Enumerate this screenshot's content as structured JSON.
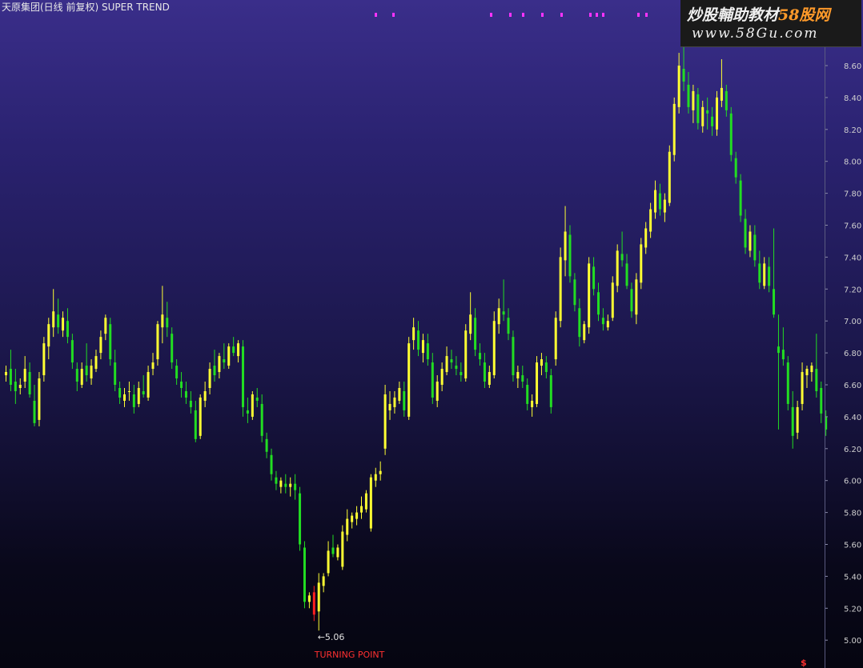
{
  "header": {
    "title": "天原集团(日线 前复权) SUPER TREND"
  },
  "watermark": {
    "text_main": "炒股輔助教材",
    "text_brand": "58股网",
    "url": "www.58Gu.com"
  },
  "axis_marker": "$",
  "colors": {
    "up": "#ffff33",
    "down": "#22dd22",
    "turn": "#ff2020",
    "annotation_low": "#e0e0e0",
    "annotation_turn": "#ff3030",
    "top_markers": "#ff33ff"
  },
  "chart_data": {
    "type": "candlestick",
    "title": "天原集团(日线 前复权) SUPER TREND",
    "ylim": [
      4.9,
      8.8
    ],
    "y_ticks": [
      "5.00",
      "5.20",
      "5.40",
      "5.60",
      "5.80",
      "6.00",
      "6.20",
      "6.40",
      "6.60",
      "6.80",
      "7.00",
      "7.20",
      "7.40",
      "7.60",
      "7.80",
      "8.00",
      "8.20",
      "8.40",
      "8.60"
    ],
    "grid": false,
    "annotations": {
      "low_label": "←5.06",
      "low_value": 5.06,
      "turning_label": "TURNING POINT"
    },
    "candles": [
      [
        6.66,
        6.72,
        6.62,
        6.68
      ],
      [
        6.7,
        6.82,
        6.56,
        6.6
      ],
      [
        6.62,
        6.7,
        6.48,
        6.56
      ],
      [
        6.58,
        6.64,
        6.54,
        6.6
      ],
      [
        6.62,
        6.78,
        6.58,
        6.7
      ],
      [
        6.68,
        6.74,
        6.52,
        6.54
      ],
      [
        6.5,
        6.6,
        6.34,
        6.36
      ],
      [
        6.38,
        6.68,
        6.34,
        6.64
      ],
      [
        6.66,
        6.9,
        6.62,
        6.86
      ],
      [
        6.84,
        7.02,
        6.76,
        6.98
      ],
      [
        6.96,
        7.2,
        6.9,
        7.06
      ],
      [
        7.04,
        7.14,
        6.92,
        6.96
      ],
      [
        6.94,
        7.06,
        6.9,
        7.02
      ],
      [
        7.0,
        7.08,
        6.86,
        6.9
      ],
      [
        6.88,
        6.92,
        6.7,
        6.74
      ],
      [
        6.7,
        6.74,
        6.56,
        6.62
      ],
      [
        6.6,
        6.74,
        6.58,
        6.7
      ],
      [
        6.72,
        6.86,
        6.62,
        6.66
      ],
      [
        6.64,
        6.76,
        6.6,
        6.72
      ],
      [
        6.7,
        6.82,
        6.68,
        6.78
      ],
      [
        6.8,
        6.94,
        6.76,
        6.9
      ],
      [
        6.92,
        7.04,
        6.88,
        7.02
      ],
      [
        6.98,
        7.02,
        6.72,
        6.76
      ],
      [
        6.74,
        6.82,
        6.56,
        6.6
      ],
      [
        6.58,
        6.62,
        6.48,
        6.52
      ],
      [
        6.5,
        6.58,
        6.46,
        6.54
      ],
      [
        6.56,
        6.62,
        6.5,
        6.56
      ],
      [
        6.54,
        6.6,
        6.42,
        6.46
      ],
      [
        6.48,
        6.62,
        6.46,
        6.58
      ],
      [
        6.56,
        6.66,
        6.52,
        6.54
      ],
      [
        6.52,
        6.72,
        6.5,
        6.68
      ],
      [
        6.7,
        6.8,
        6.66,
        6.74
      ],
      [
        6.76,
        7.0,
        6.72,
        6.98
      ],
      [
        6.96,
        7.22,
        6.86,
        7.04
      ],
      [
        7.02,
        7.12,
        6.9,
        6.96
      ],
      [
        6.92,
        6.96,
        6.7,
        6.74
      ],
      [
        6.72,
        6.76,
        6.6,
        6.64
      ],
      [
        6.62,
        6.68,
        6.52,
        6.58
      ],
      [
        6.56,
        6.62,
        6.48,
        6.52
      ],
      [
        6.5,
        6.56,
        6.42,
        6.46
      ],
      [
        6.44,
        6.5,
        6.24,
        6.26
      ],
      [
        6.28,
        6.54,
        6.26,
        6.52
      ],
      [
        6.5,
        6.62,
        6.46,
        6.56
      ],
      [
        6.58,
        6.74,
        6.54,
        6.7
      ],
      [
        6.72,
        6.82,
        6.62,
        6.66
      ],
      [
        6.68,
        6.8,
        6.64,
        6.78
      ],
      [
        6.76,
        6.86,
        6.7,
        6.74
      ],
      [
        6.72,
        6.86,
        6.7,
        6.84
      ],
      [
        6.84,
        6.9,
        6.78,
        6.8
      ],
      [
        6.78,
        6.88,
        6.74,
        6.86
      ],
      [
        6.84,
        6.88,
        6.4,
        6.46
      ],
      [
        6.44,
        6.52,
        6.36,
        6.42
      ],
      [
        6.4,
        6.56,
        6.38,
        6.54
      ],
      [
        6.52,
        6.58,
        6.46,
        6.5
      ],
      [
        6.48,
        6.54,
        6.24,
        6.28
      ],
      [
        6.26,
        6.3,
        6.14,
        6.18
      ],
      [
        6.16,
        6.2,
        6.0,
        6.04
      ],
      [
        6.02,
        6.06,
        5.94,
        5.98
      ],
      [
        5.96,
        6.02,
        5.92,
        6.0
      ],
      [
        5.98,
        6.04,
        5.92,
        5.96
      ],
      [
        5.96,
        6.02,
        5.9,
        5.98
      ],
      [
        5.98,
        6.04,
        5.88,
        5.94
      ],
      [
        5.92,
        5.96,
        5.56,
        5.6
      ],
      [
        5.58,
        5.62,
        5.2,
        5.24
      ],
      [
        5.24,
        5.3,
        5.2,
        5.28
      ],
      [
        5.3,
        5.34,
        5.12,
        5.16
      ],
      [
        5.18,
        5.42,
        5.06,
        5.36
      ],
      [
        5.34,
        5.42,
        5.3,
        5.4
      ],
      [
        5.42,
        5.62,
        5.4,
        5.56
      ],
      [
        5.58,
        5.66,
        5.52,
        5.54
      ],
      [
        5.52,
        5.6,
        5.5,
        5.58
      ],
      [
        5.46,
        5.72,
        5.44,
        5.68
      ],
      [
        5.66,
        5.82,
        5.62,
        5.76
      ],
      [
        5.74,
        5.8,
        5.7,
        5.78
      ],
      [
        5.76,
        5.84,
        5.72,
        5.8
      ],
      [
        5.8,
        5.9,
        5.76,
        5.84
      ],
      [
        5.82,
        5.94,
        5.8,
        5.92
      ],
      [
        5.7,
        6.04,
        5.68,
        6.02
      ],
      [
        6.0,
        6.08,
        5.96,
        6.04
      ],
      [
        6.04,
        6.12,
        6.0,
        6.06
      ],
      [
        6.2,
        6.6,
        6.16,
        6.54
      ],
      [
        6.44,
        6.56,
        6.38,
        6.48
      ],
      [
        6.46,
        6.56,
        6.42,
        6.52
      ],
      [
        6.5,
        6.62,
        6.48,
        6.58
      ],
      [
        6.56,
        6.62,
        6.4,
        6.44
      ],
      [
        6.4,
        6.9,
        6.38,
        6.86
      ],
      [
        6.88,
        7.02,
        6.82,
        6.96
      ],
      [
        6.94,
        7.0,
        6.78,
        6.82
      ],
      [
        6.8,
        6.92,
        6.74,
        6.88
      ],
      [
        6.86,
        6.92,
        6.72,
        6.76
      ],
      [
        6.74,
        6.8,
        6.48,
        6.52
      ],
      [
        6.5,
        6.66,
        6.46,
        6.62
      ],
      [
        6.6,
        6.74,
        6.56,
        6.7
      ],
      [
        6.68,
        6.84,
        6.66,
        6.78
      ],
      [
        6.76,
        6.82,
        6.7,
        6.74
      ],
      [
        6.72,
        6.78,
        6.66,
        6.7
      ],
      [
        6.68,
        6.74,
        6.62,
        6.66
      ],
      [
        6.64,
        6.98,
        6.62,
        6.94
      ],
      [
        6.92,
        7.18,
        6.88,
        7.04
      ],
      [
        7.02,
        7.08,
        6.78,
        6.82
      ],
      [
        6.8,
        6.86,
        6.72,
        6.76
      ],
      [
        6.74,
        6.8,
        6.58,
        6.62
      ],
      [
        6.6,
        6.72,
        6.58,
        6.68
      ],
      [
        6.66,
        7.06,
        6.64,
        7.0
      ],
      [
        6.98,
        7.14,
        6.92,
        7.08
      ],
      [
        7.06,
        7.26,
        7.0,
        7.04
      ],
      [
        7.02,
        7.08,
        6.88,
        6.92
      ],
      [
        6.9,
        6.94,
        6.62,
        6.66
      ],
      [
        6.64,
        6.72,
        6.58,
        6.68
      ],
      [
        6.66,
        6.72,
        6.58,
        6.62
      ],
      [
        6.6,
        6.64,
        6.44,
        6.48
      ],
      [
        6.46,
        6.54,
        6.4,
        6.5
      ],
      [
        6.48,
        6.78,
        6.46,
        6.74
      ],
      [
        6.72,
        6.8,
        6.66,
        6.76
      ],
      [
        6.74,
        6.78,
        6.64,
        6.68
      ],
      [
        6.66,
        6.7,
        6.42,
        6.46
      ],
      [
        6.76,
        7.06,
        6.72,
        7.02
      ],
      [
        7.0,
        7.46,
        6.96,
        7.4
      ],
      [
        7.38,
        7.72,
        7.28,
        7.56
      ],
      [
        7.54,
        7.6,
        7.24,
        7.28
      ],
      [
        7.26,
        7.3,
        7.06,
        7.1
      ],
      [
        7.08,
        7.14,
        6.84,
        6.9
      ],
      [
        6.88,
        7.0,
        6.86,
        6.98
      ],
      [
        6.96,
        7.4,
        6.92,
        7.36
      ],
      [
        7.34,
        7.4,
        7.16,
        7.2
      ],
      [
        7.18,
        7.24,
        7.0,
        7.04
      ],
      [
        7.02,
        7.08,
        6.94,
        6.98
      ],
      [
        6.96,
        7.04,
        6.94,
        7.0
      ],
      [
        7.02,
        7.28,
        7.0,
        7.24
      ],
      [
        7.22,
        7.48,
        7.18,
        7.44
      ],
      [
        7.42,
        7.56,
        7.34,
        7.38
      ],
      [
        7.36,
        7.42,
        7.2,
        7.22
      ],
      [
        7.2,
        7.24,
        7.02,
        7.06
      ],
      [
        7.04,
        7.3,
        6.98,
        7.26
      ],
      [
        7.24,
        7.52,
        7.2,
        7.48
      ],
      [
        7.46,
        7.62,
        7.42,
        7.58
      ],
      [
        7.56,
        7.74,
        7.52,
        7.7
      ],
      [
        7.68,
        7.88,
        7.64,
        7.82
      ],
      [
        7.8,
        7.86,
        7.66,
        7.7
      ],
      [
        7.68,
        7.8,
        7.62,
        7.76
      ],
      [
        7.74,
        8.1,
        7.72,
        8.06
      ],
      [
        8.04,
        8.4,
        8.0,
        8.36
      ],
      [
        8.34,
        8.68,
        8.3,
        8.6
      ],
      [
        8.58,
        8.76,
        8.44,
        8.5
      ],
      [
        8.48,
        8.56,
        8.3,
        8.34
      ],
      [
        8.32,
        8.48,
        8.24,
        8.44
      ],
      [
        8.42,
        8.46,
        8.2,
        8.24
      ],
      [
        8.22,
        8.38,
        8.18,
        8.34
      ],
      [
        8.32,
        8.4,
        8.2,
        8.3
      ],
      [
        8.28,
        8.34,
        8.16,
        8.22
      ],
      [
        8.2,
        8.44,
        8.16,
        8.4
      ],
      [
        8.38,
        8.64,
        8.34,
        8.46
      ],
      [
        8.44,
        8.48,
        8.28,
        8.32
      ],
      [
        8.3,
        8.34,
        8.0,
        8.04
      ],
      [
        8.02,
        8.06,
        7.86,
        7.9
      ],
      [
        7.88,
        7.92,
        7.62,
        7.66
      ],
      [
        7.64,
        7.7,
        7.42,
        7.46
      ],
      [
        7.44,
        7.6,
        7.4,
        7.56
      ],
      [
        7.54,
        7.6,
        7.34,
        7.38
      ],
      [
        7.36,
        7.44,
        7.2,
        7.24
      ],
      [
        7.22,
        7.4,
        7.2,
        7.36
      ],
      [
        7.34,
        7.4,
        7.18,
        7.22
      ],
      [
        7.2,
        7.58,
        7.02,
        7.04
      ],
      [
        6.84,
        7.04,
        6.32,
        6.8
      ],
      [
        6.82,
        6.96,
        6.72,
        6.76
      ],
      [
        6.74,
        6.78,
        6.44,
        6.48
      ],
      [
        6.46,
        6.56,
        6.2,
        6.28
      ],
      [
        6.3,
        6.5,
        6.26,
        6.46
      ],
      [
        6.48,
        6.74,
        6.44,
        6.68
      ],
      [
        6.66,
        6.72,
        6.58,
        6.7
      ],
      [
        6.68,
        6.74,
        6.62,
        6.72
      ],
      [
        6.7,
        6.92,
        6.52,
        6.56
      ],
      [
        6.58,
        6.62,
        6.36,
        6.42
      ],
      [
        6.4,
        6.44,
        6.28,
        6.32
      ]
    ]
  }
}
